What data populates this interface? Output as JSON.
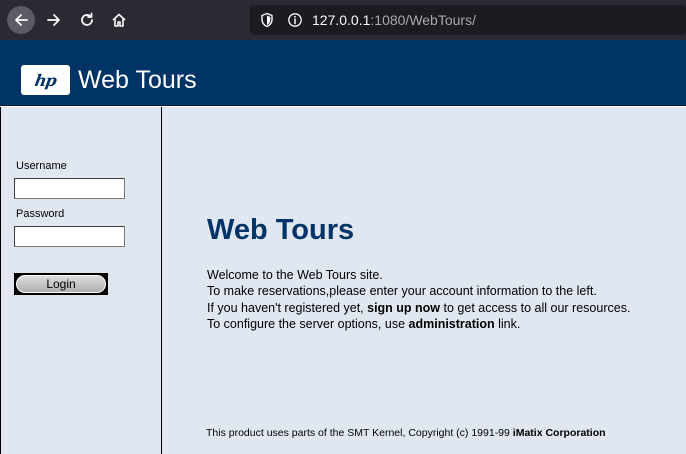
{
  "browser": {
    "url_host": "127.0.0.1",
    "url_path": ":1080/WebTours/"
  },
  "header": {
    "logo_text": "hp",
    "title": "Web Tours"
  },
  "sidebar": {
    "username_label": "Username",
    "username_value": "",
    "password_label": "Password",
    "password_value": "",
    "login_label": "Login"
  },
  "main": {
    "title": "Web Tours",
    "line1": "Welcome to the Web Tours site.",
    "line2": "To make reservations,please enter your account information to the left.",
    "line3_pre": "If you haven't registered yet, ",
    "line3_link": "sign up now",
    "line3_post": " to get access to all our resources.",
    "line4_pre": "To configure the server options, use ",
    "line4_link": "administration",
    "line4_post": " link.",
    "footer_pre": "This product uses parts of the SMT Kernel, Copyright (c) 1991-99 ",
    "footer_bold": "iMatix Corporation"
  },
  "icons": {
    "back": "back-arrow-icon",
    "forward": "forward-arrow-icon",
    "reload": "reload-icon",
    "home": "home-icon",
    "shield": "shield-icon",
    "info": "info-icon"
  },
  "colors": {
    "header_bg": "#003366",
    "content_bg": "#e0e7f1",
    "title_color": "#003366",
    "browser_bg": "#2b2a33"
  }
}
